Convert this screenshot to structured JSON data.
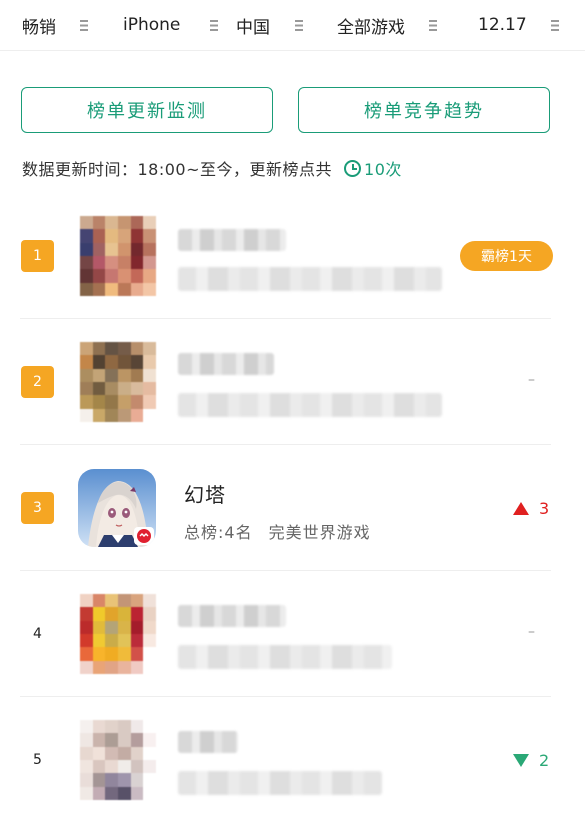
{
  "filters": [
    {
      "label": "畅销",
      "icon": "menu-icon"
    },
    {
      "label": "iPhone",
      "icon": "menu-icon"
    },
    {
      "label": "中国",
      "icon": "menu-icon"
    },
    {
      "label": "全部游戏",
      "icon": "menu-icon"
    },
    {
      "label": "12.17",
      "icon": "menu-icon"
    }
  ],
  "actions": {
    "monitor_label": "榜单更新监测",
    "trend_label": "榜单竞争趋势"
  },
  "update_info": {
    "text": "数据更新时间：18:00~至今，更新榜点共",
    "icon": "clock-icon",
    "count": "10次"
  },
  "colors": {
    "accent": "#1a9c78",
    "badge": "#f5a623",
    "rise": "#e02020",
    "fall": "#2aa876"
  },
  "ranking": [
    {
      "rank": "1",
      "top_badge": "霸榜1天"
    },
    {
      "rank": "2",
      "change": "–"
    },
    {
      "rank": "3",
      "name": "幻塔",
      "total_rank": "总榜:4名",
      "publisher": "完美世界游戏",
      "change_dir": "up",
      "change_value": "3"
    },
    {
      "rank": "4",
      "change": "–"
    },
    {
      "rank": "5",
      "change_dir": "down",
      "change_value": "2"
    }
  ]
}
